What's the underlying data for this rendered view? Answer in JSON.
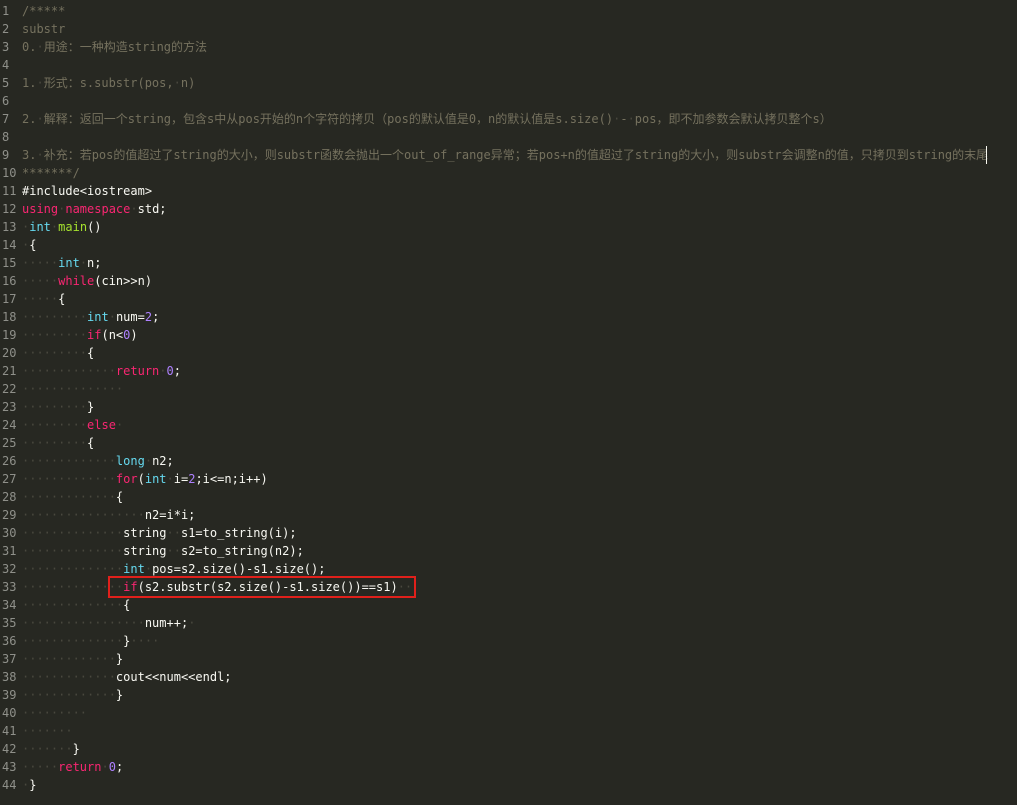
{
  "editor": {
    "theme_colors": {
      "background": "#272822",
      "comment": "#75715e",
      "plain": "#f8f8f2",
      "keyword": "#f92672",
      "type": "#66d9ef",
      "function": "#a6e22e",
      "number": "#ae81ff",
      "whitespace_marker": "#49483e",
      "line_number": "#8f908a",
      "highlight_box": "#e0201b"
    },
    "highlight_line": 33,
    "caret_line": 9,
    "lines": [
      {
        "n": "1",
        "tokens": [
          [
            "cm",
            "/*****"
          ]
        ]
      },
      {
        "n": "2",
        "tokens": [
          [
            "cm",
            "substr"
          ]
        ]
      },
      {
        "n": "3",
        "tokens": [
          [
            "cm",
            "0."
          ],
          [
            "ws",
            "·"
          ],
          [
            "cm",
            "用途：一种构造string的方法"
          ]
        ]
      },
      {
        "n": "4",
        "tokens": []
      },
      {
        "n": "5",
        "tokens": [
          [
            "cm",
            "1."
          ],
          [
            "ws",
            "·"
          ],
          [
            "cm",
            "形式：s.substr(pos,"
          ],
          [
            "ws",
            "·"
          ],
          [
            "cm",
            "n)"
          ]
        ]
      },
      {
        "n": "6",
        "tokens": []
      },
      {
        "n": "7",
        "tokens": [
          [
            "cm",
            "2."
          ],
          [
            "ws",
            "·"
          ],
          [
            "cm",
            "解释：返回一个string，包含s中从pos开始的n个字符的拷贝（pos的默认值是0，n的默认值是s.size()"
          ],
          [
            "ws",
            "·"
          ],
          [
            "cm",
            "-"
          ],
          [
            "ws",
            "·"
          ],
          [
            "cm",
            "pos，即不加参数会默认拷贝整个s）"
          ]
        ]
      },
      {
        "n": "8",
        "tokens": []
      },
      {
        "n": "9",
        "tokens": [
          [
            "cm",
            "3."
          ],
          [
            "ws",
            "·"
          ],
          [
            "cm",
            "补充：若pos的值超过了string的大小，则substr函数会抛出一个out_of_range异常；若pos+n的值超过了string的大小，则substr会调整n的值，只拷贝到string的末尾"
          ]
        ]
      },
      {
        "n": "10",
        "tokens": [
          [
            "cm",
            "*******/"
          ]
        ]
      },
      {
        "n": "11",
        "tokens": [
          [
            "pl",
            "#include<iostream>"
          ]
        ]
      },
      {
        "n": "12",
        "tokens": [
          [
            "kw",
            "using"
          ],
          [
            "ws",
            "·"
          ],
          [
            "kw",
            "namespace"
          ],
          [
            "ws",
            "·"
          ],
          [
            "pl",
            "std;"
          ]
        ]
      },
      {
        "n": "13",
        "tokens": [
          [
            "ws",
            "·"
          ],
          [
            "ty",
            "int"
          ],
          [
            "ws",
            "·"
          ],
          [
            "fn",
            "main"
          ],
          [
            "pl",
            "()"
          ]
        ]
      },
      {
        "n": "14",
        "tokens": [
          [
            "ws",
            "·"
          ],
          [
            "pl",
            "{"
          ]
        ]
      },
      {
        "n": "15",
        "tokens": [
          [
            "ws",
            "·····"
          ],
          [
            "ty",
            "int"
          ],
          [
            "ws",
            "·"
          ],
          [
            "pl",
            "n;"
          ]
        ]
      },
      {
        "n": "16",
        "tokens": [
          [
            "ws",
            "·····"
          ],
          [
            "kw",
            "while"
          ],
          [
            "pl",
            "(cin>>n)"
          ]
        ]
      },
      {
        "n": "17",
        "tokens": [
          [
            "ws",
            "·····"
          ],
          [
            "pl",
            "{"
          ]
        ]
      },
      {
        "n": "18",
        "tokens": [
          [
            "ws",
            "·········"
          ],
          [
            "ty",
            "int"
          ],
          [
            "ws",
            "·"
          ],
          [
            "pl",
            "num="
          ],
          [
            "nm",
            "2"
          ],
          [
            "pl",
            ";"
          ]
        ]
      },
      {
        "n": "19",
        "tokens": [
          [
            "ws",
            "·········"
          ],
          [
            "kw",
            "if"
          ],
          [
            "pl",
            "(n<"
          ],
          [
            "nm",
            "0"
          ],
          [
            "pl",
            ")"
          ]
        ]
      },
      {
        "n": "20",
        "tokens": [
          [
            "ws",
            "·········"
          ],
          [
            "pl",
            "{"
          ]
        ]
      },
      {
        "n": "21",
        "tokens": [
          [
            "ws",
            "·············"
          ],
          [
            "kw",
            "return"
          ],
          [
            "ws",
            "·"
          ],
          [
            "nm",
            "0"
          ],
          [
            "pl",
            ";"
          ]
        ]
      },
      {
        "n": "22",
        "tokens": [
          [
            "ws",
            "··············"
          ]
        ]
      },
      {
        "n": "23",
        "tokens": [
          [
            "ws",
            "·········"
          ],
          [
            "pl",
            "}"
          ]
        ]
      },
      {
        "n": "24",
        "tokens": [
          [
            "ws",
            "·········"
          ],
          [
            "kw",
            "else"
          ],
          [
            "ws",
            "·"
          ]
        ]
      },
      {
        "n": "25",
        "tokens": [
          [
            "ws",
            "·········"
          ],
          [
            "pl",
            "{"
          ]
        ]
      },
      {
        "n": "26",
        "tokens": [
          [
            "ws",
            "·············"
          ],
          [
            "ty",
            "long"
          ],
          [
            "ws",
            "·"
          ],
          [
            "pl",
            "n2;"
          ]
        ]
      },
      {
        "n": "27",
        "tokens": [
          [
            "ws",
            "·············"
          ],
          [
            "kw",
            "for"
          ],
          [
            "pl",
            "("
          ],
          [
            "ty",
            "int"
          ],
          [
            "ws",
            "·"
          ],
          [
            "pl",
            "i="
          ],
          [
            "nm",
            "2"
          ],
          [
            "pl",
            ";i<=n;i++)"
          ]
        ]
      },
      {
        "n": "28",
        "tokens": [
          [
            "ws",
            "·············"
          ],
          [
            "pl",
            "{"
          ]
        ]
      },
      {
        "n": "29",
        "tokens": [
          [
            "ws",
            "·················"
          ],
          [
            "pl",
            "n2=i*i;"
          ]
        ]
      },
      {
        "n": "30",
        "tokens": [
          [
            "ws",
            "··············"
          ],
          [
            "pl",
            "string"
          ],
          [
            "ws",
            "··"
          ],
          [
            "pl",
            "s1=to_string(i);"
          ]
        ]
      },
      {
        "n": "31",
        "tokens": [
          [
            "ws",
            "··············"
          ],
          [
            "pl",
            "string"
          ],
          [
            "ws",
            "··"
          ],
          [
            "pl",
            "s2=to_string(n2);"
          ]
        ]
      },
      {
        "n": "32",
        "tokens": [
          [
            "ws",
            "··············"
          ],
          [
            "ty",
            "int"
          ],
          [
            "ws",
            "·"
          ],
          [
            "pl",
            "pos=s2.size()-s1.size();"
          ]
        ]
      },
      {
        "n": "33",
        "tokens": [
          [
            "ws",
            "··············"
          ],
          [
            "kw",
            "if"
          ],
          [
            "pl",
            "(s2.substr(s2.size()-s1.size())==s1)"
          ],
          [
            "ws",
            "··"
          ]
        ]
      },
      {
        "n": "34",
        "tokens": [
          [
            "ws",
            "··············"
          ],
          [
            "pl",
            "{"
          ]
        ]
      },
      {
        "n": "35",
        "tokens": [
          [
            "ws",
            "·················"
          ],
          [
            "pl",
            "num++;"
          ],
          [
            "ws",
            "·"
          ]
        ]
      },
      {
        "n": "36",
        "tokens": [
          [
            "ws",
            "··············"
          ],
          [
            "pl",
            "}"
          ],
          [
            "ws",
            "····"
          ]
        ]
      },
      {
        "n": "37",
        "tokens": [
          [
            "ws",
            "·············"
          ],
          [
            "pl",
            "}"
          ]
        ]
      },
      {
        "n": "38",
        "tokens": [
          [
            "ws",
            "·············"
          ],
          [
            "pl",
            "cout<<num<<endl;"
          ]
        ]
      },
      {
        "n": "39",
        "tokens": [
          [
            "ws",
            "·············"
          ],
          [
            "pl",
            "}"
          ]
        ]
      },
      {
        "n": "40",
        "tokens": [
          [
            "ws",
            "·········"
          ]
        ]
      },
      {
        "n": "41",
        "tokens": [
          [
            "ws",
            "·······"
          ]
        ]
      },
      {
        "n": "42",
        "tokens": [
          [
            "ws",
            "·······"
          ],
          [
            "pl",
            "}"
          ]
        ]
      },
      {
        "n": "43",
        "tokens": [
          [
            "ws",
            "·····"
          ],
          [
            "kw",
            "return"
          ],
          [
            "ws",
            "·"
          ],
          [
            "nm",
            "0"
          ],
          [
            "pl",
            ";"
          ]
        ]
      },
      {
        "n": "44",
        "tokens": [
          [
            "ws",
            "·"
          ],
          [
            "pl",
            "}"
          ]
        ]
      }
    ]
  }
}
